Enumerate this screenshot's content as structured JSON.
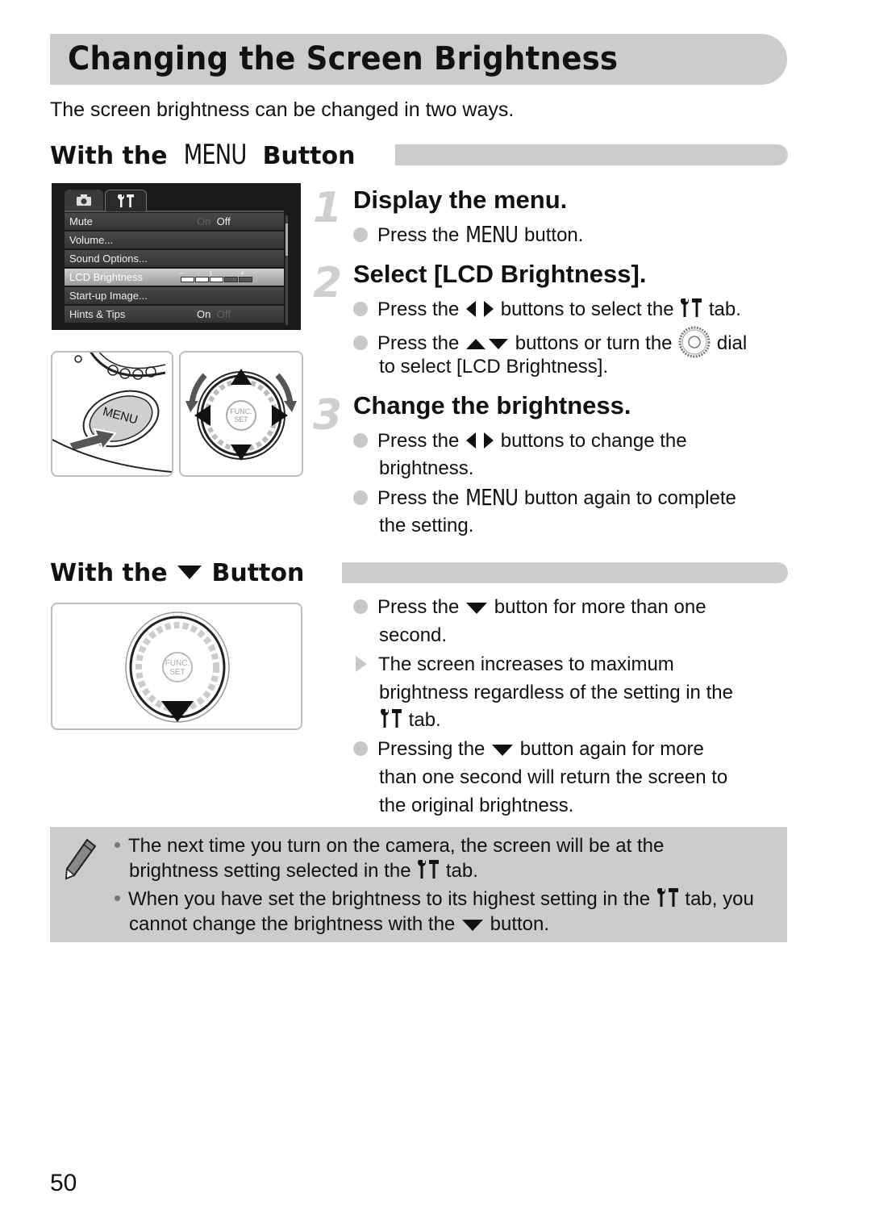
{
  "page": {
    "title": "Changing the Screen Brightness",
    "intro": "The screen brightness can be changed in two ways.",
    "page_number": "50"
  },
  "section_menu": {
    "heading_prefix": "With the",
    "heading_key": "MENU",
    "heading_suffix": "Button",
    "lcd_screen": {
      "tabs": [
        {
          "icon": "camera-icon",
          "label": "◘",
          "active": false
        },
        {
          "icon": "wrench-hammer-icon",
          "label": "ϒΤ",
          "active": true
        }
      ],
      "rows": [
        {
          "label": "Mute",
          "value_off": "On",
          "value_on": "Off",
          "selected": false
        },
        {
          "label": "Volume...",
          "selected": false
        },
        {
          "label": "Sound Options...",
          "selected": false
        },
        {
          "label": "LCD Brightness",
          "selected": true,
          "brightness_level": 3,
          "brightness_max": 5,
          "minus": "−",
          "mid": "I",
          "plus": "+"
        },
        {
          "label": "Start-up Image...",
          "selected": false
        },
        {
          "label": "Hints & Tips",
          "value_on": "On",
          "value_off": "Off",
          "selected": false
        }
      ]
    },
    "illustration_left": {
      "button_label": "MENU"
    },
    "illustration_right": {
      "center_label_1": "FUNC.",
      "center_label_2": "SET"
    },
    "steps": [
      {
        "number": "1",
        "title": "Display the menu.",
        "bullets": [
          {
            "pre": "Press the",
            "key": "MENU",
            "post": "button."
          }
        ]
      },
      {
        "number": "2",
        "title": "Select [LCD Brightness].",
        "bullets": [
          {
            "pre": "Press the",
            "mid": "buttons to select the",
            "post": "tab."
          },
          {
            "pre": "Press the",
            "mid": "buttons or turn the",
            "post": "dial",
            "cont": "to select [LCD Brightness]."
          }
        ]
      },
      {
        "number": "3",
        "title": "Change the brightness.",
        "bullets": [
          {
            "pre": "Press the",
            "post": "buttons to change the",
            "cont": "brightness."
          },
          {
            "pre": "Press the",
            "key": "MENU",
            "post": "button again to complete",
            "cont": "the setting."
          }
        ]
      }
    ]
  },
  "section_down": {
    "heading_prefix": "With the",
    "heading_suffix": "Button",
    "illustration": {
      "center_label_1": "FUNC.",
      "center_label_2": "SET"
    },
    "bullets": [
      {
        "type": "dot",
        "pre": "Press the",
        "post": "button for more than one",
        "cont": "second."
      },
      {
        "type": "arrow",
        "line1": "The screen increases to maximum",
        "line2": "brightness regardless of the setting in the",
        "line3_post": "tab."
      },
      {
        "type": "dot",
        "pre": "Pressing the",
        "post": "button again for more",
        "cont1": "than one second will return the screen to",
        "cont2": "the original brightness."
      }
    ]
  },
  "note": {
    "icon": "pencil-icon",
    "items": [
      {
        "line1": "The next time you turn on the camera, the screen will be at the",
        "line2_pre": "brightness setting selected in the",
        "line2_post": "tab."
      },
      {
        "line1_pre": "When you have set the brightness to its highest setting in the",
        "line1_post": "tab, you",
        "line2_pre": "cannot change the brightness with the",
        "line2_post": "button."
      }
    ]
  }
}
